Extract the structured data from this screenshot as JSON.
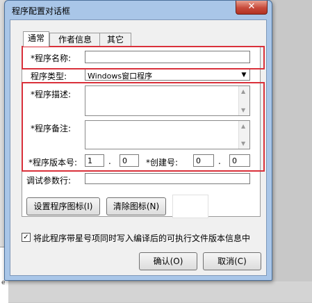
{
  "dialog": {
    "title": "程序配置对话框",
    "close_glyph": "✕"
  },
  "tabs": [
    {
      "label": "通常"
    },
    {
      "label": "作者信息"
    },
    {
      "label": "其它"
    }
  ],
  "form": {
    "name_label": "*程序名称:",
    "name_value": "",
    "type_label": "程序类型:",
    "type_value": "Windows窗口程序",
    "desc_label": "*程序描述:",
    "note_label": "*程序备注:",
    "version_label": "*程序版本号:",
    "version_major": "1",
    "version_minor": "0",
    "dot": ".",
    "build_label": "*创建号:",
    "build_major": "0",
    "build_minor": "0",
    "debug_label": "调试参数行:",
    "debug_value": ""
  },
  "buttons": {
    "set_icon": "设置程序图标(I)",
    "clear_icon": "清除图标(N)",
    "ok": "确认(O)",
    "cancel": "取消(C)"
  },
  "checkbox": {
    "checked": true,
    "mark": "✓",
    "label": "将此程序带星号项同时写入编译后的可执行文件版本信息中"
  },
  "scroll_glyphs": {
    "up": "▲",
    "down": "▼"
  },
  "colors": {
    "highlight": "#d9303a",
    "title_bar": "#a9c6e8",
    "close_button": "#c7493a"
  }
}
